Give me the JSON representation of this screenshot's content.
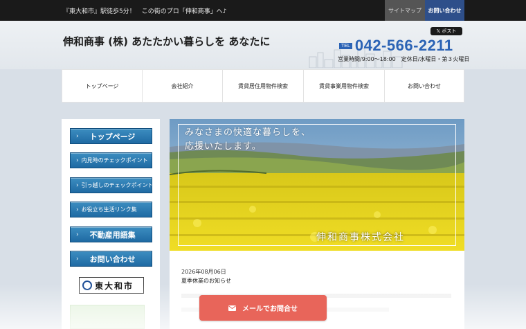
{
  "topbar": {
    "tagline": "『東大和市』駅徒歩5分！　この街のプロ「伸和商事」へ♪",
    "sitemap_label": "サイトマップ",
    "contact_label": "お問い合わせ"
  },
  "header": {
    "site_title": "伸和商事 (株) あたたかい暮らしを あなたに",
    "post_label": "𝕏 ポスト",
    "tel_label": "TEL",
    "tel_number": "042-566-2211",
    "hours": "営業時間/9:00～18:00　定休日/水曜日・第３火曜日"
  },
  "nav": {
    "items": [
      {
        "label": "トップページ"
      },
      {
        "label": "会社紹介"
      },
      {
        "label": "賃貸居住用物件検索"
      },
      {
        "label": "賃貸事業用物件検索"
      },
      {
        "label": "お問い合わせ"
      }
    ]
  },
  "sidebar": {
    "items": [
      {
        "label": "トップページ"
      },
      {
        "label": "内見時のチェックポイント"
      },
      {
        "label": "引っ越しのチェックポイント"
      },
      {
        "label": "お役立ち生活リンク集"
      },
      {
        "label": "不動産用語集"
      },
      {
        "label": "お問い合わせ"
      }
    ],
    "city_logo_text": "東大和市"
  },
  "hero": {
    "line1": "みなさまの快適な暮らしを、",
    "line2": "応援いたします。",
    "company": "伸和商事株式会社"
  },
  "news": {
    "date": "2026年08月06日",
    "title": "夏季休業のお知らせ"
  },
  "footer_cta": {
    "mail_label": "メールでお問合せ"
  },
  "colors": {
    "accent_blue": "#2b63b5",
    "sidebar_button": "#1f6aa3",
    "cta": "#e8655a",
    "field_yellow": "#e6d21a",
    "sky_blue": "#8fb3d2"
  },
  "icons": {
    "chevron": "chevron-right-icon",
    "mail": "mail-icon"
  }
}
